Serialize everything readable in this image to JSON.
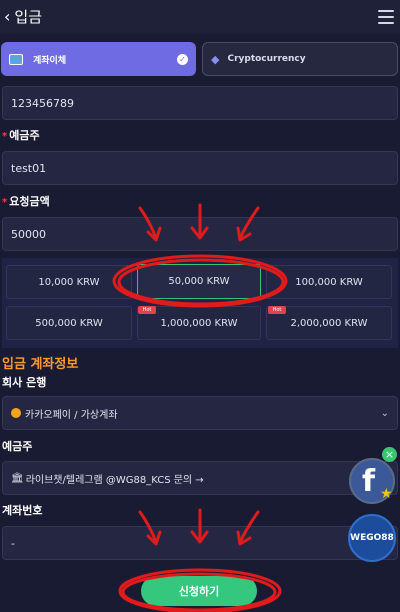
{
  "header": {
    "back_label": "입금"
  },
  "tabs": [
    {
      "label": "계좌이체"
    },
    {
      "label": "Cryptocurrency"
    }
  ],
  "form": {
    "account_value": "123456789",
    "depositor_label": "예금주",
    "depositor_value": "test01",
    "amount_label": "요청금액",
    "amount_value": "50000",
    "required_mark": "*"
  },
  "amounts": [
    {
      "label": "10,000 KRW",
      "hot": false
    },
    {
      "label": "50,000 KRW",
      "hot": false,
      "selected": true
    },
    {
      "label": "100,000 KRW",
      "hot": false
    },
    {
      "label": "500,000 KRW",
      "hot": false
    },
    {
      "label": "1,000,000 KRW",
      "hot": true
    },
    {
      "label": "2,000,000 KRW",
      "hot": true
    }
  ],
  "hot_badge": "Hot",
  "deposit_info": {
    "title": "입금 계좌정보",
    "bank_label": "회사 은행",
    "bank_value": "카카오페이 / 가상계좌",
    "holder_label": "예금주",
    "holder_value": "라이브챗/텔레그램 @WG88_KCS 문의 →",
    "number_label": "계좌번호",
    "number_value": "-"
  },
  "submit_label": "신청하기",
  "floating": {
    "close_icon": "×",
    "facebook_letter": "f",
    "brand_text": "WEGO88"
  },
  "colors": {
    "accent_purple": "#6f6be3",
    "accent_green": "#35c77d",
    "section_orange": "#ff9a2f",
    "annotation_red": "#e11b1b"
  }
}
